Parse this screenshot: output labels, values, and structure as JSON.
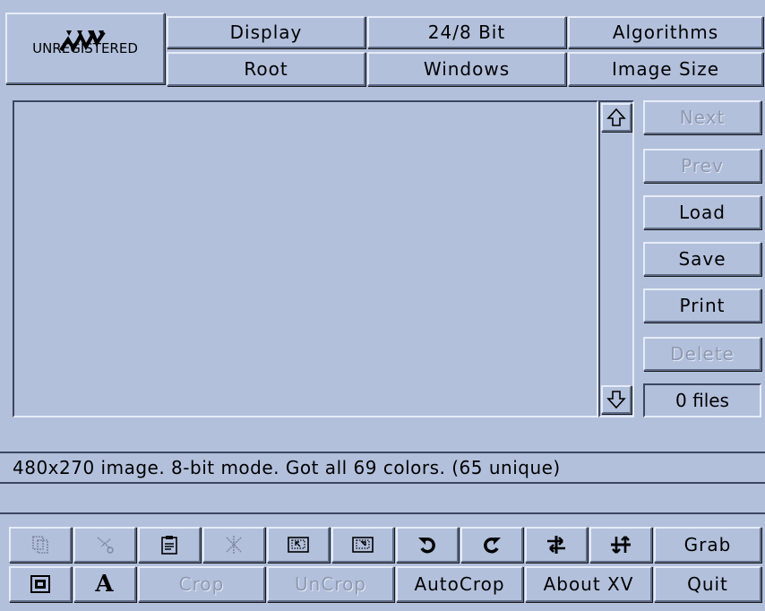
{
  "logo": {
    "text": "UNREGISTERED"
  },
  "menu": {
    "display": "Display",
    "bit": "24/8 Bit",
    "algorithms": "Algorithms",
    "root": "Root",
    "windows": "Windows",
    "image_size": "Image Size"
  },
  "side": {
    "next": "Next",
    "prev": "Prev",
    "load": "Load",
    "save": "Save",
    "print": "Print",
    "delete": "Delete",
    "files": "0 files"
  },
  "status": {
    "line1": "480x270 image.  8-bit mode.  Got all 69 colors.  (65 unique)",
    "line2": ""
  },
  "bottom": {
    "grab": "Grab",
    "text_icon_glyph": "A",
    "crop": "Crop",
    "uncrop": "UnCrop",
    "autocrop": "AutoCrop",
    "about": "About XV",
    "quit": "Quit"
  },
  "icons": [
    "copy-icon",
    "cut-icon",
    "paste-icon",
    "clear-icon",
    "pad-icon",
    "annotate-icon",
    "rotate-left-icon",
    "rotate-right-icon",
    "flip-horizontal-icon",
    "flip-vertical-icon",
    "info-icon",
    "text-icon",
    "scroll-up-icon",
    "scroll-down-icon"
  ],
  "colors": {
    "background": "#b2c0dc",
    "highlight": "#e6ecf7",
    "shadow": "#5d6a86"
  }
}
